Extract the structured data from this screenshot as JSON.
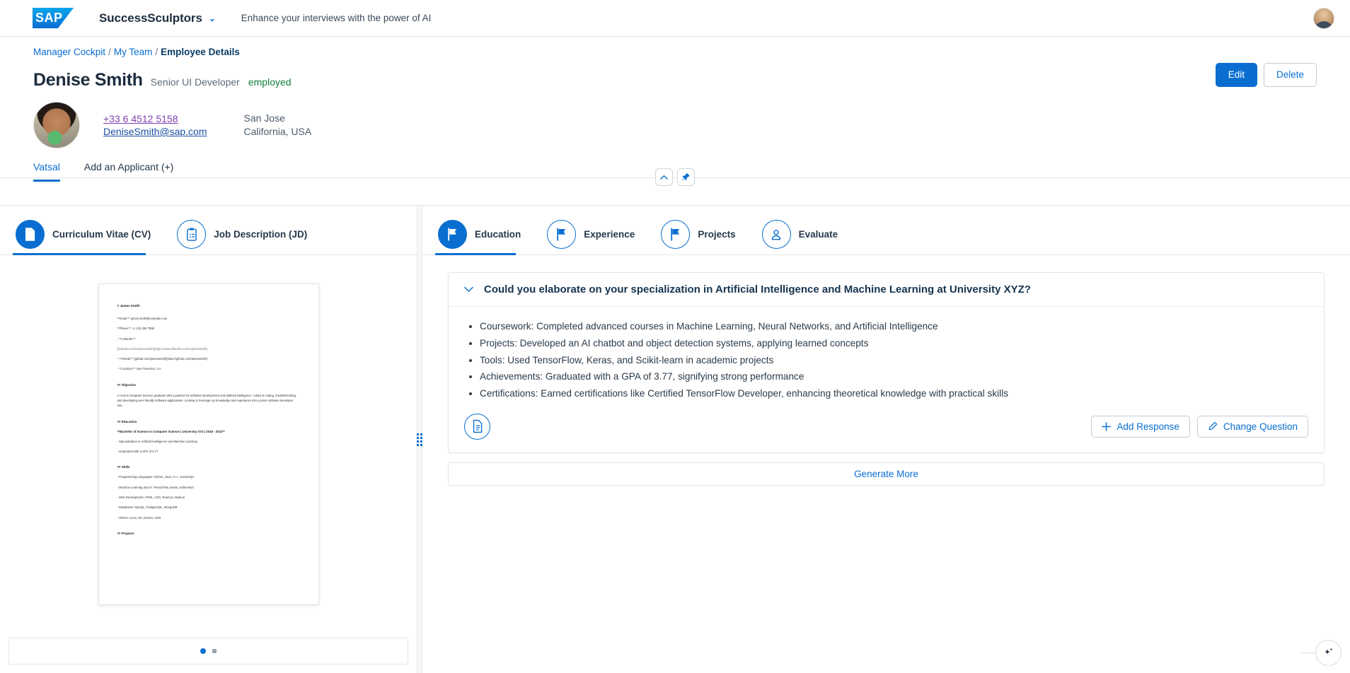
{
  "shell": {
    "logo_text": "SAP",
    "app_title": "SuccessSculptors",
    "app_subtitle": "Enhance your interviews with the power of AI",
    "chevron": "⌄"
  },
  "breadcrumb": {
    "item1": "Manager Cockpit",
    "item2": "My Team",
    "current": "Employee Details",
    "sep": "/"
  },
  "employee": {
    "name": "Denise Smith",
    "role": "Senior UI Developer",
    "status": "employed",
    "phone": "+33 6 4512 5158",
    "email": "DeniseSmith@sap.com",
    "city": "San Jose",
    "region": "California, USA"
  },
  "header_actions": {
    "edit": "Edit",
    "delete": "Delete"
  },
  "applicant_tabs": [
    {
      "label": "Vatsal",
      "selected": true
    },
    {
      "label": "Add an Applicant (+)",
      "selected": false
    }
  ],
  "center_controls": {
    "collapse": "⌃",
    "pin": "📌"
  },
  "left_tabs": [
    {
      "label": "Curriculum Vitae (CV)",
      "icon": "document-icon",
      "selected": true
    },
    {
      "label": "Job Description (JD)",
      "icon": "clipboard-list-icon",
      "selected": false
    }
  ],
  "right_tabs": [
    {
      "label": "Education",
      "icon": "flag-icon",
      "selected": true
    },
    {
      "label": "Experience",
      "icon": "flag-icon",
      "selected": false
    },
    {
      "label": "Projects",
      "icon": "flag-icon",
      "selected": false
    },
    {
      "label": "Evaluate",
      "icon": "person-icon",
      "selected": false
    }
  ],
  "cv_document": {
    "name": "# James Smith",
    "email": "**Email:** james.smith@example.com",
    "phone": "**Phone:** +1 123 456 7890",
    "linkedin_label": "- **LinkedIn:**",
    "linkedin_url": "[linkedin.com/in/jamessmith](https://www.linkedin.com/in/jamessmith)",
    "github": "- **GitHub:** [github.com/jamessmith](https://github.com/jamessmith)",
    "location": "- **Location:** San Francisco, CA",
    "objective_heading": "## Objective",
    "objective_text": "A recent Computer Science graduate with a passion for software development and artificial intelligence. Adept at coding, troubleshooting, and developing user-friendly software applications. Looking to leverage my knowledge and experience into a junior software developer role.",
    "education_heading": "## Education",
    "education_degree": "**Bachelor of Science in Computer Science | University XYZ | 2018 - 2022**",
    "education_line1": "- Specialization in Artificial Intelligence and Machine Learning",
    "education_line2": "- Graduated with a GPA of 3.77",
    "skills_heading": "## Skills",
    "skills_line1": "- Programming Languages: Python, Java, C++, JavaScript",
    "skills_line2": "- Machine Learning and AI: TensorFlow, Keras, Scikit-learn",
    "skills_line3": "- Web Development: HTML, CSS, React.js, Node.js",
    "skills_line4": "- Databases: MySQL, PostgreSQL, MongoDB",
    "skills_line5": "- Others: Linux, Git, Docker, AWS",
    "projects_heading": "## Projects"
  },
  "cv_pager": {
    "page_current": 1,
    "page_total": 2
  },
  "qa": {
    "question": "Could you elaborate on your specialization in Artificial Intelligence and Machine Learning at University XYZ?",
    "caret": "⌄",
    "answers": [
      "Coursework: Completed advanced courses in Machine Learning, Neural Networks, and Artificial Intelligence",
      "Projects: Developed an AI chatbot and object detection systems, applying learned concepts",
      "Tools: Used TensorFlow, Keras, and Scikit-learn in academic projects",
      "Achievements: Graduated with a GPA of 3.77, signifying strong performance",
      "Certifications: Earned certifications like Certified TensorFlow Developer, enhancing theoretical knowledge with practical skills"
    ],
    "add_response": "Add Response",
    "change_question": "Change Question",
    "generate_more": "Generate More",
    "summary_icon": "document-summary-icon"
  },
  "fab": {
    "icon": "ai-sparkle-icon"
  },
  "colors": {
    "brand_blue": "#0a6ed1",
    "status_green": "#107e3e",
    "title_dark": "#1d2d3e",
    "page_bg": "#ffffff"
  }
}
